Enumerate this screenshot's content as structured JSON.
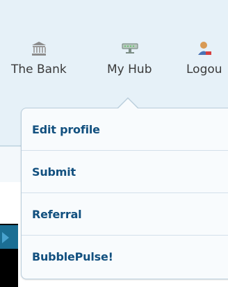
{
  "nav": {
    "items": [
      {
        "label": "The Bank",
        "icon": "bank-icon"
      },
      {
        "label": "My Hub",
        "icon": "hub-icon"
      },
      {
        "label": "Logou",
        "icon": "logout-icon"
      }
    ]
  },
  "dropdown": {
    "items": [
      {
        "label": "Edit profile"
      },
      {
        "label": "Submit"
      },
      {
        "label": "Referral"
      },
      {
        "label": "BubblePulse!"
      }
    ]
  },
  "colors": {
    "menu_text": "#12507f",
    "nav_text": "#3a3a3a",
    "top_background": "#e6f1f8"
  }
}
